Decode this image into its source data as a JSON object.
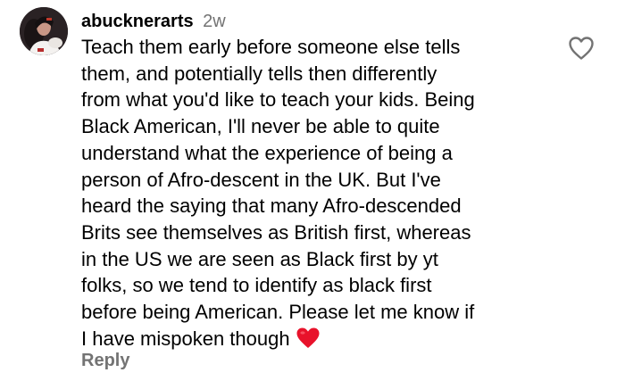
{
  "comment": {
    "username": "abucknerarts",
    "timestamp": "2w",
    "text": "Teach them early before someone else tells\nthem, and potentially tells then differently\nfrom what you'd like to teach your kids. Being\nBlack American, I'll never be able to quite\nunderstand what the experience of being a\nperson of Afro-descent in the UK. But I've\nheard the saying that many Afro-descended\nBrits see themselves as British first, whereas\nin the US we are seen as Black first by yt\nfolks, so we tend to identify as black first\nbefore being American. Please let me know if\nI have mispoken though",
    "emoji": "red-heart",
    "reply_label": "Reply",
    "like_icon": "heart-outline-icon"
  },
  "colors": {
    "text": "#000000",
    "muted": "#737373",
    "emoji_heart": "#e8122b"
  }
}
